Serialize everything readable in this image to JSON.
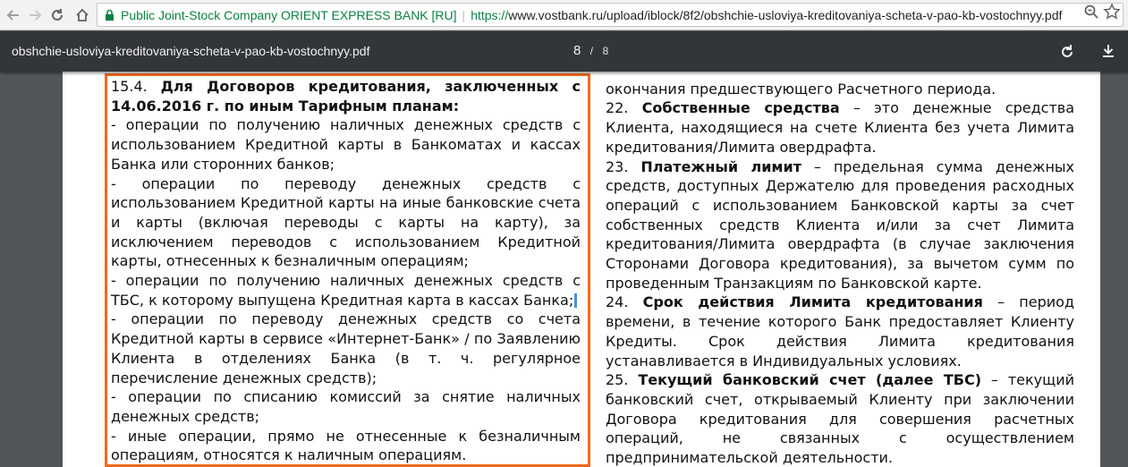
{
  "browser": {
    "ev_name": "Public Joint-Stock Company ORIENT EXPRESS BANK [RU]",
    "url_sep": "|",
    "url_scheme": "https://",
    "url_rest": "www.vostbank.ru/upload/iblock/8f2/obshchie-usloviya-kreditovaniya-scheta-v-pao-kb-vostochnyy.pdf"
  },
  "pdf_toolbar": {
    "title": "obshchie-usloviya-kreditovaniya-scheta-v-pao-kb-vostochnyy.pdf",
    "page_current": "8",
    "page_sep": "/",
    "page_total": "8"
  },
  "colors": {
    "highlight": "#f0691a",
    "ev_green": "#0b8043",
    "toolbar_bg": "#323639",
    "viewer_bg": "#525659"
  },
  "left_column": {
    "clause_number": "15.4.",
    "clause_title": "Для Договоров кредитования, заключенных с 14.06.2016 г. по иным Тарифным планам:",
    "items": [
      "- операции по получению наличных денежных средств с использованием Кредитной карты в Банкоматах и кассах Банка или сторонних банков;",
      "- операции по переводу денежных средств с использованием Кредитной карты на иные банковские счета и карты (включая переводы с карты на карту), за исключением переводов с использованием Кредитной карты, отнесенных к безналичным операциям;",
      "- операции по получению наличных денежных средств с ТБС, к которому выпущена Кредитная карта в кассах Банка;",
      "- операции по переводу денежных средств со счета Кредитной карты в сервисе «Интернет-Банк» / по Заявлению Клиента в отделениях Банка (в т. ч. регулярное перечисление денежных средств);",
      "- операции по списанию комиссий за снятие наличных денежных средств;",
      "- иные операции, прямо не отнесенные к безналичным операциям, относятся к наличным операциям."
    ]
  },
  "right_column": {
    "top_line": "окончания предшествующего Расчетного периода.",
    "defs": [
      {
        "number": "22.",
        "term": "Собственные средства",
        "text": " – это денежные средства Клиента, находящиеся на счете Клиента без учета Лимита кредитования/Лимита овердрафта."
      },
      {
        "number": "23.",
        "term": "Платежный лимит",
        "text": " – предельная сумма денежных средств, доступных Держателю для проведения расходных операций с использованием Банковской карты за счет собственных средств Клиента и/или за счет Лимита кредитования/Лимита овердрафта (в случае заключения Сторонами Договора кредитования), за вычетом сумм по проведенным Транзакциям по Банковской карте."
      },
      {
        "number": "24.",
        "term": "Срок действия Лимита кредитования",
        "text": " – период времени, в течение которого Банк предоставляет Клиенту Кредиты. Срок действия Лимита кредитования устанавливается в Индивидуальных условиях."
      },
      {
        "number": "25.",
        "term": "Текущий банковский счет (далее ТБС)",
        "text": " – текущий банковский счет, открываемый Клиенту при заключении Договора кредитования для совершения расчетных операций, не связанных с осуществлением предпринимательской деятельности."
      }
    ]
  }
}
